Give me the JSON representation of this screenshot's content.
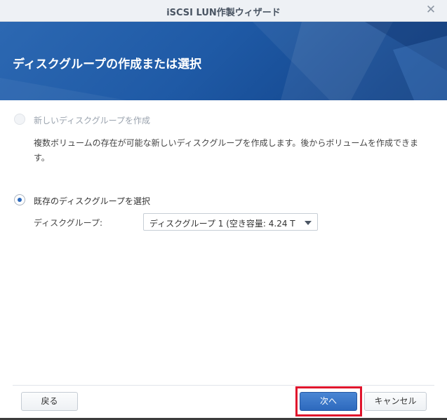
{
  "window": {
    "title": "iSCSI LUN作製ウィザード",
    "close_icon": "close-icon"
  },
  "banner": {
    "title": "ディスクグループの作成または選択",
    "accent": "#1f5aa6"
  },
  "options": {
    "create_new": {
      "label": "新しいディスクグループを作成",
      "description": "複数ボリュームの存在が可能な新しいディスクグループを作成します。後からボリュームを作成できます。",
      "selected": false,
      "enabled": false
    },
    "select_existing": {
      "label": "既存のディスクグループを選択",
      "selected": true,
      "field_label": "ディスクグループ:",
      "field_value": "ディスクグループ 1 (空き容量: 4.24 T"
    }
  },
  "footer": {
    "back_label": "戻る",
    "next_label": "次へ",
    "cancel_label": "キャンセル",
    "highlight_color": "#e0142c"
  }
}
